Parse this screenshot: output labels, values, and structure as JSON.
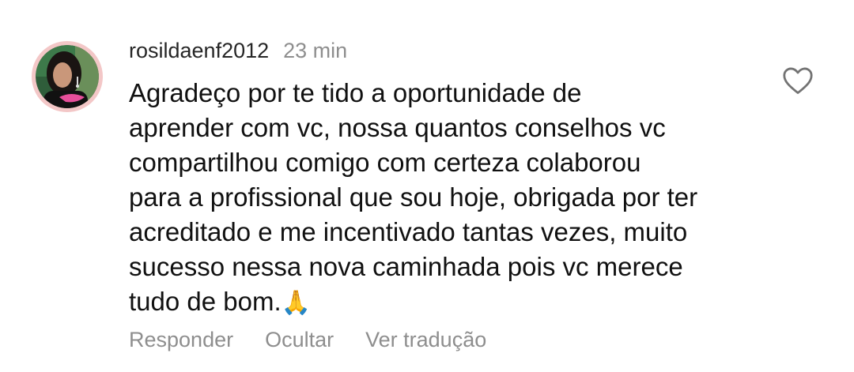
{
  "comment": {
    "username": "rosildaenf2012",
    "timestamp": "23 min",
    "text": "Agradeço por te tido a oportunidade de\naprender com vc, nossa quantos conselhos vc\ncompartilhou comigo com certeza colaborou\npara a profissional que sou hoje, obrigada por ter\nacreditado e me incentivado tantas vezes, muito\nsucesso nessa nova caminhada pois vc merece\ntudo de bom.",
    "emoji": "🙏",
    "like_icon": "heart-outline-icon",
    "avatar_icon": "user-avatar"
  },
  "actions": {
    "reply_label": "Responder",
    "hide_label": "Ocultar",
    "translate_label": "Ver tradução"
  },
  "colors": {
    "text_primary": "#262626",
    "text_secondary": "#8e8e8e",
    "avatar_ring": "#f3c7c7"
  }
}
